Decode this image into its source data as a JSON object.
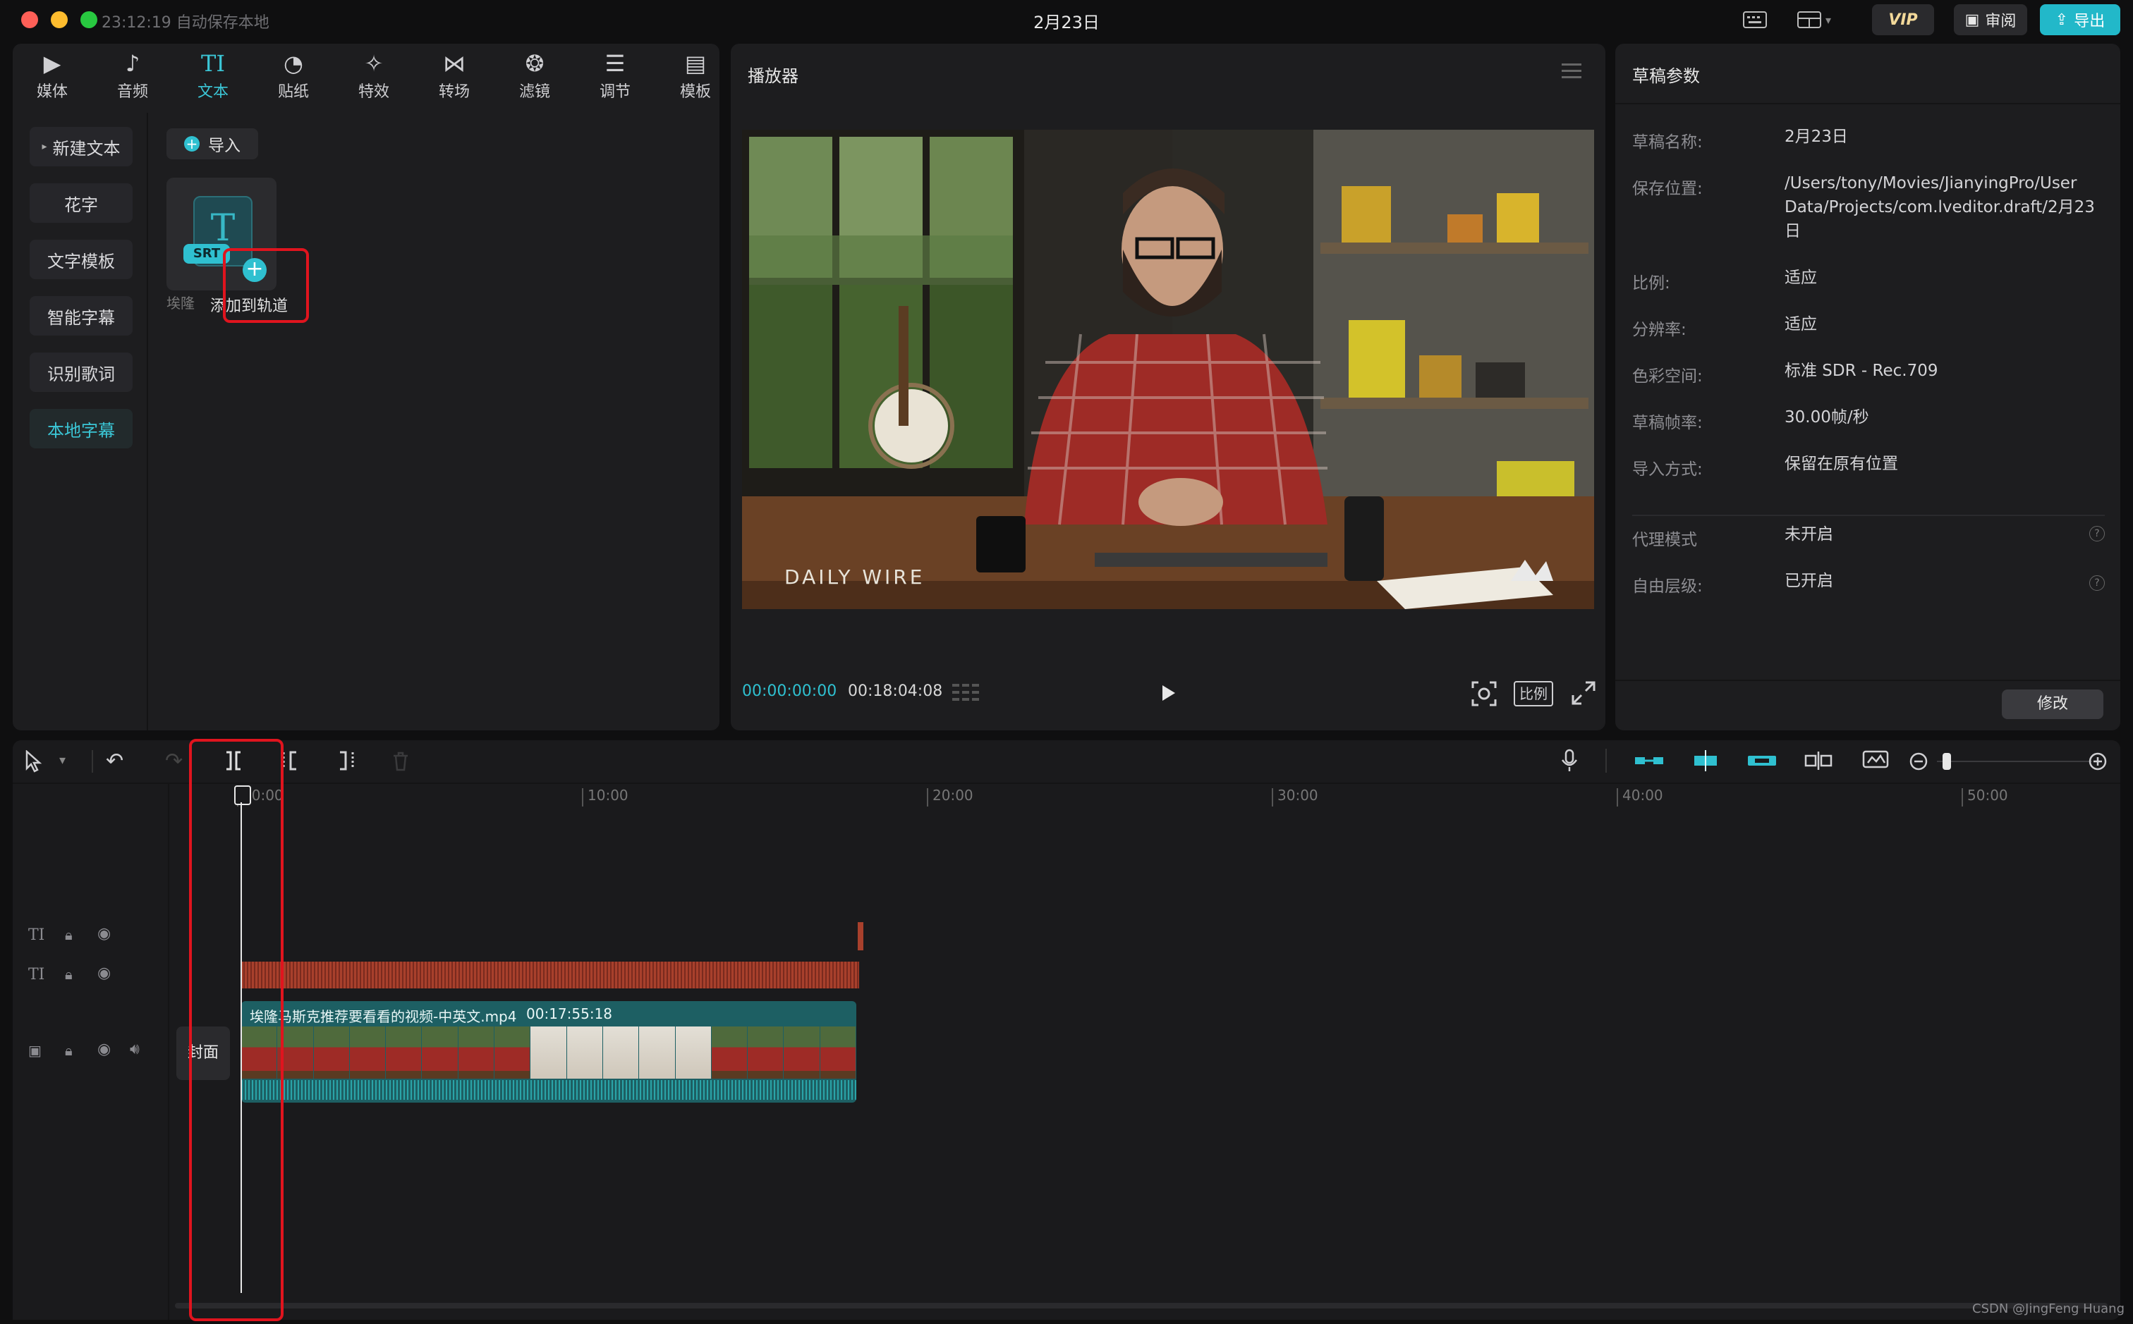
{
  "window": {
    "autosave": "23:12:19 自动保存本地",
    "title": "2月23日",
    "vip": "VIP",
    "review": "审阅",
    "export": "导出"
  },
  "toolbar": {
    "tabs": [
      {
        "label": "媒体",
        "icon": "media-icon"
      },
      {
        "label": "音频",
        "icon": "audio-icon"
      },
      {
        "label": "文本",
        "icon": "text-icon",
        "active": true
      },
      {
        "label": "贴纸",
        "icon": "sticker-icon"
      },
      {
        "label": "特效",
        "icon": "effects-icon"
      },
      {
        "label": "转场",
        "icon": "transition-icon"
      },
      {
        "label": "滤镜",
        "icon": "filter-icon"
      },
      {
        "label": "调节",
        "icon": "adjust-icon"
      },
      {
        "label": "模板",
        "icon": "template-icon"
      }
    ]
  },
  "sidebar": {
    "items": [
      {
        "label": "新建文本"
      },
      {
        "label": "花字"
      },
      {
        "label": "文字模板"
      },
      {
        "label": "智能字幕"
      },
      {
        "label": "识别歌词"
      },
      {
        "label": "本地字幕",
        "active": true
      }
    ]
  },
  "library": {
    "import_label": "导入",
    "item_badge": "SRT",
    "item_name": "埃隆",
    "add_to_track": "添加到轨道"
  },
  "player": {
    "title": "播放器",
    "current_time": "00:00:00:00",
    "total_time": "00:18:04:08",
    "ratio_label": "比例",
    "watermark": "DAILY WIRE"
  },
  "properties": {
    "title": "草稿参数",
    "rows": [
      {
        "label": "草稿名称:",
        "value": "2月23日"
      },
      {
        "label": "保存位置:",
        "value": "/Users/tony/Movies/JianyingPro/User Data/Projects/com.lveditor.draft/2月23日"
      },
      {
        "label": "比例:",
        "value": "适应"
      },
      {
        "label": "分辨率:",
        "value": "适应"
      },
      {
        "label": "色彩空间:",
        "value": "标准 SDR - Rec.709"
      },
      {
        "label": "草稿帧率:",
        "value": "30.00帧/秒"
      },
      {
        "label": "导入方式:",
        "value": "保留在原有位置"
      },
      {
        "label": "代理模式",
        "value": "未开启"
      },
      {
        "label": "自由层级:",
        "value": "已开启"
      }
    ],
    "modify_button": "修改"
  },
  "timeline": {
    "ticks": [
      "00:00",
      "10:00",
      "20:00",
      "30:00",
      "40:00",
      "50:00"
    ],
    "cover_label": "封面",
    "clip_name": "埃隆马斯克推荐要看看的视频-中英文.mp4",
    "clip_duration": "00:17:55:18"
  },
  "footer": {
    "credit": "CSDN @JingFeng Huang"
  },
  "colors": {
    "accent": "#3bc6d6",
    "highlight_box": "#e0141e",
    "audio_track": "#a8402c",
    "video_track": "#1f6f6f"
  }
}
